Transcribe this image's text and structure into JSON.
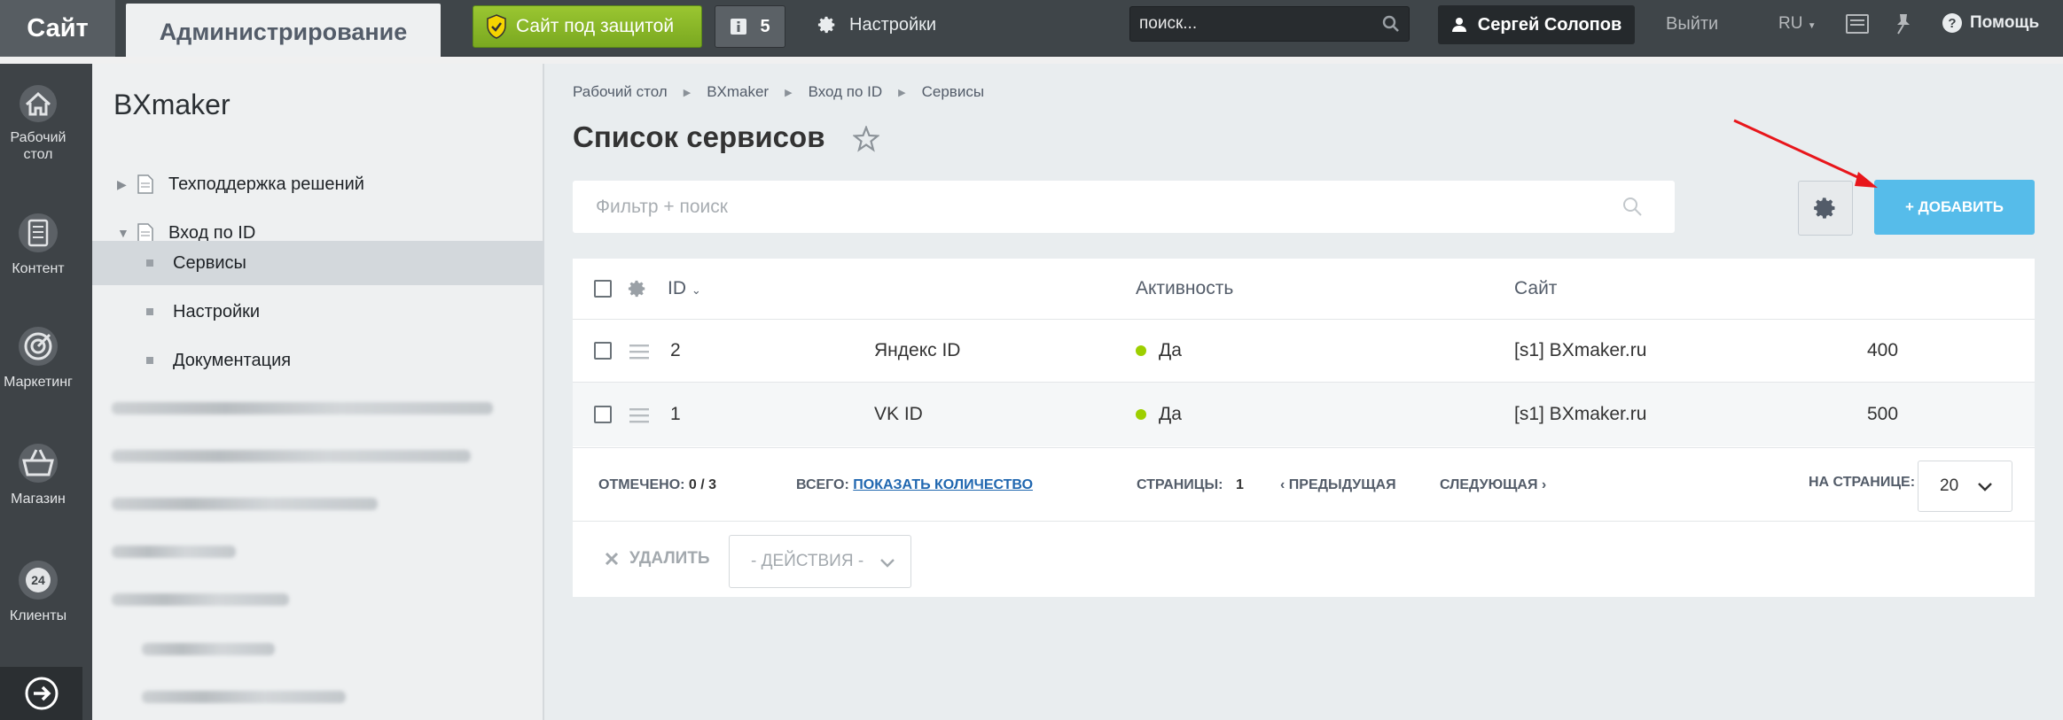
{
  "topbar": {
    "site_tab": "Сайт",
    "admin_tab": "Администрирование",
    "protected_label": "Сайт под защитой",
    "notifications_count": "5",
    "settings_label": "Настройки",
    "search_placeholder": "поиск...",
    "user_name": "Сергей Солопов",
    "logout_label": "Выйти",
    "lang_label": "RU",
    "help_label": "Помощь"
  },
  "iconbar": {
    "items": [
      {
        "label": "Рабочий стол",
        "icon": "home-icon"
      },
      {
        "label": "Контент",
        "icon": "document-icon"
      },
      {
        "label": "Маркетинг",
        "icon": "target-icon"
      },
      {
        "label": "Магазин",
        "icon": "basket-icon"
      },
      {
        "label": "Клиенты",
        "icon": "clients-24-icon"
      }
    ]
  },
  "tree": {
    "title": "BXmaker",
    "items": [
      {
        "label": "Техподдержка решений"
      },
      {
        "label": "Вход по ID"
      },
      {
        "label": "Сервисы"
      },
      {
        "label": "Настройки"
      },
      {
        "label": "Документация"
      }
    ]
  },
  "breadcrumb": [
    "Рабочий стол",
    "BXmaker",
    "Вход по ID",
    "Сервисы"
  ],
  "page": {
    "title": "Список сервисов",
    "filter_placeholder": "Фильтр + поиск",
    "add_label": "+ ДОБАВИТЬ"
  },
  "table": {
    "headers": {
      "id": "ID",
      "active": "Активность",
      "site": "Сайт"
    },
    "rows": [
      {
        "id": "2",
        "name": "Яндекс ID",
        "active": "Да",
        "site": "[s1] BXmaker.ru",
        "sort": "400"
      },
      {
        "id": "1",
        "name": "VK ID",
        "active": "Да",
        "site": "[s1] BXmaker.ru",
        "sort": "500"
      }
    ],
    "footer": {
      "checked_label": "ОТМЕЧЕНО:",
      "checked_value": "0 / 3",
      "total_label": "ВСЕГО:",
      "total_link": "ПОКАЗАТЬ КОЛИЧЕСТВО",
      "pages_label": "СТРАНИЦЫ:",
      "pages_value": "1",
      "prev_label": "ПРЕДЫДУЩАЯ",
      "next_label": "СЛЕДУЮЩАЯ",
      "per_page_label": "НА СТРАНИЦЕ:",
      "per_page_value": "20"
    },
    "actions": {
      "delete_label": "УДАЛИТЬ",
      "actions_label": "- ДЕЙСТВИЯ -"
    }
  },
  "colors": {
    "add_button": "#56bcea",
    "protect_button": "#8bb829",
    "active_dot": "#9dcf00",
    "annotation_arrow": "#e8161b"
  }
}
